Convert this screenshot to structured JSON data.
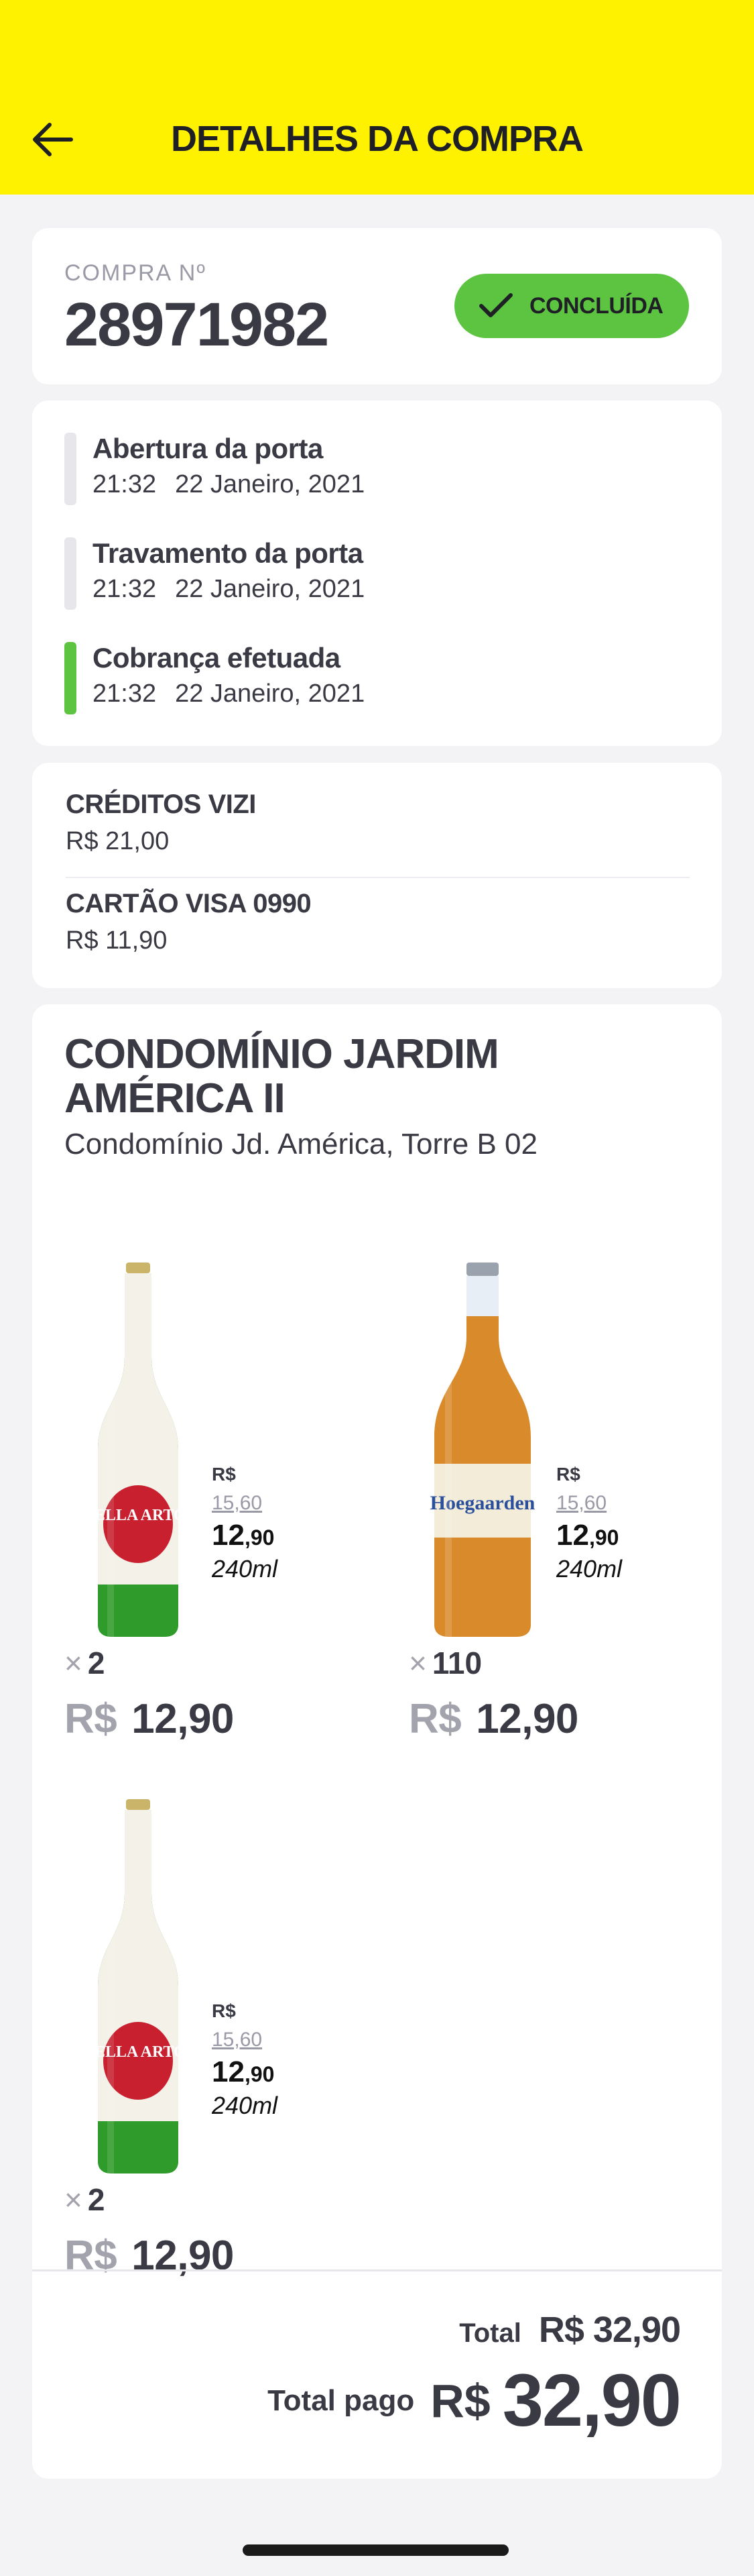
{
  "header": {
    "title": "DETALHES DA COMPRA",
    "back_icon": "arrow-left-icon"
  },
  "order": {
    "label": "COMPRA Nº",
    "number": "28971982",
    "status": "CONCLUÍDA",
    "status_color": "#5cc440"
  },
  "events": [
    {
      "title": "Abertura da porta",
      "time": "21:32",
      "date": "22 Janeiro, 2021",
      "active": false
    },
    {
      "title": "Travamento da porta",
      "time": "21:32",
      "date": "22 Janeiro, 2021",
      "active": false
    },
    {
      "title": "Cobrança efetuada",
      "time": "21:32",
      "date": "22 Janeiro, 2021",
      "active": true
    }
  ],
  "payments": [
    {
      "method": "CRÉDITOS VIZI",
      "amount": "R$ 21,00"
    },
    {
      "method": "CARTÃO VISA 0990",
      "amount": "R$ 11,90"
    }
  ],
  "store": {
    "name": "CONDOMÍNIO JARDIM AMÉRICA II",
    "address": "Condomínio Jd. América, Torre B 02"
  },
  "products": [
    {
      "brand": "STELLA ARTOIS",
      "price_currency": "R$",
      "old_price": "15,60",
      "new_price_int": "12",
      "new_price_dec": ",90",
      "volume": "240ml",
      "qty": "2",
      "line_currency": "R$",
      "line_total": "12,90"
    },
    {
      "brand": "Hoegaarden",
      "price_currency": "R$",
      "old_price": "15,60",
      "new_price_int": "12",
      "new_price_dec": ",90",
      "volume": "240ml",
      "qty": "110",
      "line_currency": "R$",
      "line_total": "12,90"
    },
    {
      "brand": "STELLA ARTOIS",
      "price_currency": "R$",
      "old_price": "15,60",
      "new_price_int": "12",
      "new_price_dec": ",90",
      "volume": "240ml",
      "qty": "2",
      "line_currency": "R$",
      "line_total": "12,90"
    }
  ],
  "totals": {
    "total_label": "Total",
    "total_value": "R$ 32,90",
    "paid_label": "Total pago",
    "paid_currency": "R$",
    "paid_value": "32,90"
  },
  "colors": {
    "header": "#fff200",
    "accent_green": "#5cc440",
    "background": "#f3f3f6"
  }
}
